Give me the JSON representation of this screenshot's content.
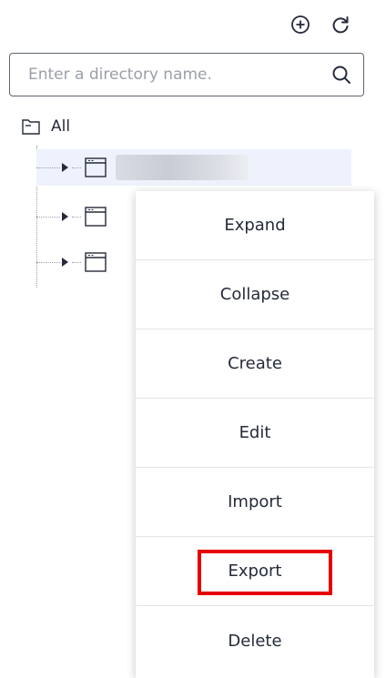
{
  "toolbar": {
    "add_icon": "plus-circle-icon",
    "refresh_icon": "refresh-icon"
  },
  "search": {
    "placeholder": "Enter a directory name.",
    "value": "",
    "icon": "search-icon"
  },
  "tree": {
    "root_label": "All",
    "root_icon": "folder-icon",
    "nodes": [
      {
        "icon": "window-icon",
        "label_hidden": true,
        "selected": true
      },
      {
        "icon": "window-icon",
        "label_hidden": true,
        "selected": false
      },
      {
        "icon": "window-icon",
        "label_hidden": true,
        "selected": false
      }
    ]
  },
  "context_menu": {
    "items": [
      "Expand",
      "Collapse",
      "Create",
      "Edit",
      "Import",
      "Export",
      "Delete"
    ],
    "highlighted_item": "Export",
    "highlight_color": "#e60000"
  },
  "colors": {
    "selected_row": "#eef2fc",
    "text": "#252b3a",
    "border": "#5e6670"
  }
}
